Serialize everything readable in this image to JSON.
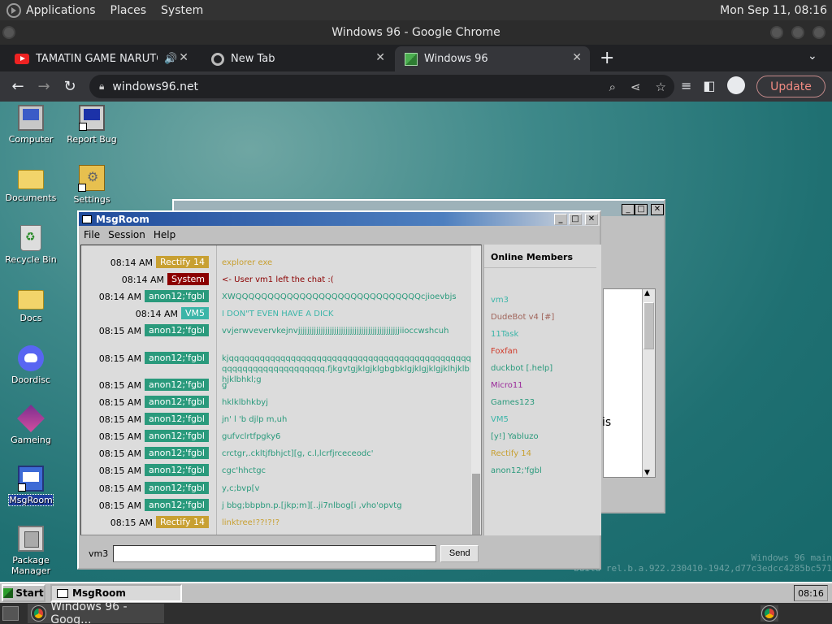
{
  "os_panel": {
    "menus": [
      "Applications",
      "Places",
      "System"
    ],
    "clock": "Mon Sep 11, 08:16"
  },
  "chrome": {
    "window_title": "Windows 96 - Google Chrome",
    "tabs": [
      {
        "title": "TAMATIN GAME NARUTO",
        "audio": "🔊",
        "close": "✕"
      },
      {
        "title": "New Tab",
        "close": "✕"
      },
      {
        "title": "Windows 96",
        "close": "✕"
      }
    ],
    "new_tab": "+",
    "tab_menu": "⌄",
    "url": "windows96.net",
    "update_label": "Update"
  },
  "desktop": {
    "icons": [
      {
        "label": "Computer"
      },
      {
        "label": "Report Bug"
      },
      {
        "label": "Documents"
      },
      {
        "label": "Settings"
      },
      {
        "label": "Recycle Bin"
      },
      {
        "label": "Docs"
      },
      {
        "label": "Doordisc"
      },
      {
        "label": "Gameing"
      },
      {
        "label": "MsgRoom"
      },
      {
        "label": "Package Manager"
      }
    ],
    "watermark_line1": "Windows 96 main",
    "watermark_line2": "build rel.b.a.922.230410-1942,d77c3edcc4285bc571"
  },
  "background_window": {
    "partial_text": "is"
  },
  "msgroom": {
    "title": "MsgRoom",
    "menu": [
      "File",
      "Session",
      "Help"
    ],
    "messages": [
      {
        "time": "08:14 AM",
        "user": "Rectify 14",
        "badge_color": "#c8a032",
        "text": "explorer exe",
        "text_color": "#c8a032"
      },
      {
        "time": "08:14 AM",
        "user": "System",
        "badge_color": "#8b0000",
        "text": "<- User vm1 left the chat :(",
        "text_color": "#8b0000"
      },
      {
        "time": "08:14 AM",
        "user": "anon12;'fgbl",
        "badge_color": "#2a9a7c",
        "text": "XWQQQQQQQQQQQQQQQQQQQQQQQQQQQQQcjioevbjs",
        "text_color": "#2a9a7c"
      },
      {
        "time": "08:14 AM",
        "user": "VM5",
        "badge_color": "#3bb5a8",
        "text": "I DON\"T EVEN HAVE A DICK",
        "text_color": "#3bb5a8"
      },
      {
        "time": "08:15 AM",
        "user": "anon12;'fgbl",
        "badge_color": "#2a9a7c",
        "text": "vvjerwvevervkejnvjjjjjjjjjjjjjjjjjjjjjjjjjjjjjjjjjjjjjjjjjjjjjiioccwshcuh",
        "text_color": "#2a9a7c"
      },
      {
        "time": "08:15 AM",
        "user": "anon12;'fgbl",
        "badge_color": "#2a9a7c",
        "text": "kjqqqqqqqqqqqqqqqqqqqqqqqqqqqqqqqqqqqqqqqqqqqqqqqqqqqqqqqqqqqqqqqqqqq.fjkgvtgjklgjklgbgbklgjklgjklgjklhjklbhjklbhkl;g",
        "text_color": "#2a9a7c"
      },
      {
        "time": "08:15 AM",
        "user": "anon12;'fgbl",
        "badge_color": "#2a9a7c",
        "text": "g",
        "text_color": "#2a9a7c"
      },
      {
        "time": "08:15 AM",
        "user": "anon12;'fgbl",
        "badge_color": "#2a9a7c",
        "text": "hklklbhkbyj",
        "text_color": "#2a9a7c"
      },
      {
        "time": "08:15 AM",
        "user": "anon12;'fgbl",
        "badge_color": "#2a9a7c",
        "text": "jn' l 'b djlp m,uh",
        "text_color": "#2a9a7c"
      },
      {
        "time": "08:15 AM",
        "user": "anon12;'fgbl",
        "badge_color": "#2a9a7c",
        "text": "gufvclrtfpgky6",
        "text_color": "#2a9a7c"
      },
      {
        "time": "08:15 AM",
        "user": "anon12;'fgbl",
        "badge_color": "#2a9a7c",
        "text": "crctgr,.ckltjfbhjct][g, c.l,lcrfjrceceodc'",
        "text_color": "#2a9a7c"
      },
      {
        "time": "08:15 AM",
        "user": "anon12;'fgbl",
        "badge_color": "#2a9a7c",
        "text": "cgc'hhctgc",
        "text_color": "#2a9a7c"
      },
      {
        "time": "08:15 AM",
        "user": "anon12;'fgbl",
        "badge_color": "#2a9a7c",
        "text": "y,c;bvp[v",
        "text_color": "#2a9a7c"
      },
      {
        "time": "08:15 AM",
        "user": "anon12;'fgbl",
        "badge_color": "#2a9a7c",
        "text": "j bbg;bbpbn.p.[jkp;m][..ji7nlbog[i ,vho'opvtg",
        "text_color": "#2a9a7c"
      },
      {
        "time": "08:15 AM",
        "user": "Rectify 14",
        "badge_color": "#c8a032",
        "text": "linktree!??!?!?",
        "text_color": "#c8a032"
      }
    ],
    "members_title": "Online Members",
    "members": [
      {
        "name": "vm3",
        "color": "#3bb5a8"
      },
      {
        "name": "DudeBot v4 [#]",
        "color": "#a0645a"
      },
      {
        "name": "11Task",
        "color": "#3bb5a8"
      },
      {
        "name": "Foxfan",
        "color": "#d03a2a"
      },
      {
        "name": "duckbot [.help]",
        "color": "#2a9a7c"
      },
      {
        "name": "Micro11",
        "color": "#9a2a9a"
      },
      {
        "name": "Games123",
        "color": "#2a9a7c"
      },
      {
        "name": "VM5",
        "color": "#3bb5a8"
      },
      {
        "name": "[y!] Yabluzo",
        "color": "#2a9a7c"
      },
      {
        "name": "Rectify 14",
        "color": "#c8a032"
      },
      {
        "name": "anon12;'fgbl",
        "color": "#2a9a7c"
      }
    ],
    "nick": "vm3",
    "input_value": "",
    "send_label": "Send"
  },
  "w96_taskbar": {
    "start_label": "Start",
    "task_label": "MsgRoom",
    "clock": "08:16"
  },
  "os_bottom": {
    "task_label": "Windows 96 - Goog..."
  }
}
